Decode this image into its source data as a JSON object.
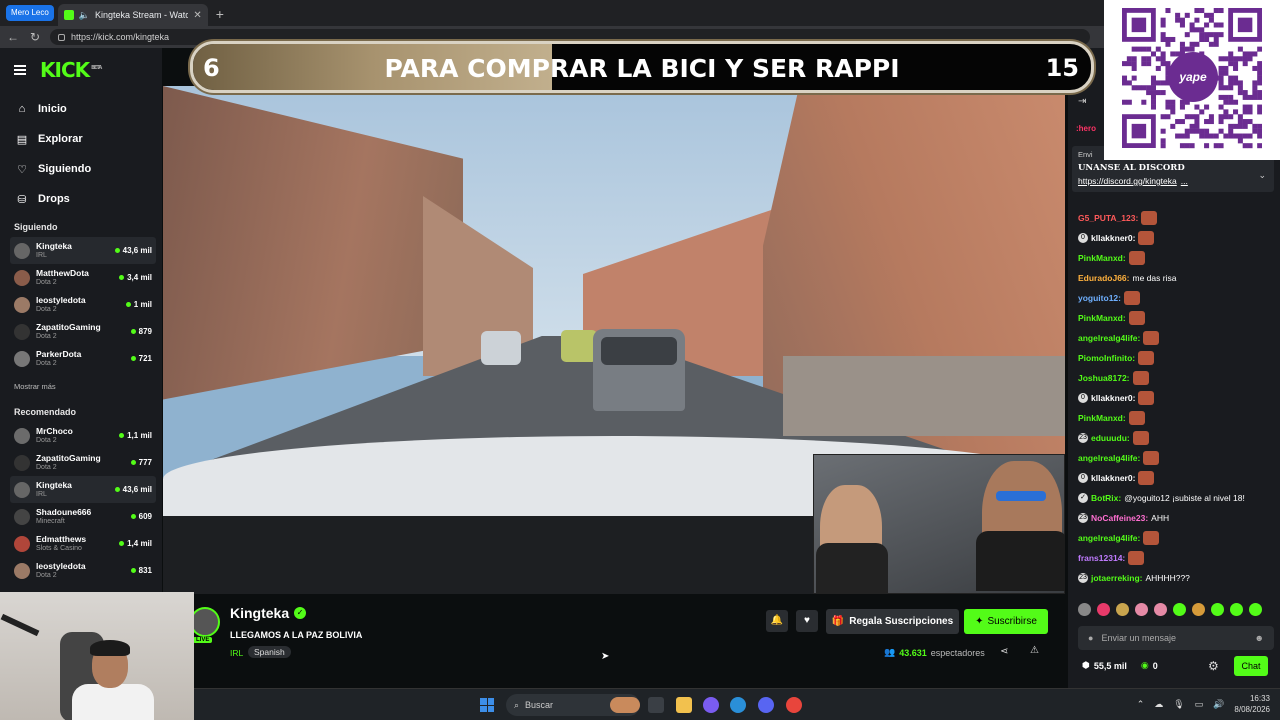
{
  "browser": {
    "tab_group": "Mero Leco",
    "tab_title": "Kingteka Stream - Watch Live",
    "url": "https://kick.com/kingteka"
  },
  "kick": {
    "logo": "KICK",
    "logo_beta": "BETA",
    "nav": [
      {
        "label": "Inicio",
        "icon": "home-icon"
      },
      {
        "label": "Explorar",
        "icon": "compass-icon"
      },
      {
        "label": "Siguiendo",
        "icon": "heart-icon"
      },
      {
        "label": "Drops",
        "icon": "drops-icon"
      }
    ],
    "following_title": "Siguiendo",
    "following": [
      {
        "name": "Kingteka",
        "category": "IRL",
        "viewers": "43,6 mil"
      },
      {
        "name": "MatthewDota",
        "category": "Dota 2",
        "viewers": "3,4 mil"
      },
      {
        "name": "leostyledota",
        "category": "Dota 2",
        "viewers": "1 mil"
      },
      {
        "name": "ZapatitoGaming",
        "category": "Dota 2",
        "viewers": "879"
      },
      {
        "name": "ParkerDota",
        "category": "Dota 2",
        "viewers": "721"
      }
    ],
    "show_more": "Mostrar más",
    "recommended_title": "Recomendado",
    "recommended": [
      {
        "name": "MrChoco",
        "category": "Dota 2",
        "viewers": "1,1 mil"
      },
      {
        "name": "ZapatitoGaming",
        "category": "Dota 2",
        "viewers": "777"
      },
      {
        "name": "Kingteka",
        "category": "IRL",
        "viewers": "43,6 mil"
      },
      {
        "name": "Shadoune666",
        "category": "Minecraft",
        "viewers": "609"
      },
      {
        "name": "Edmatthews",
        "category": "Slots & Casino",
        "viewers": "1,4 mil"
      },
      {
        "name": "leostyledota",
        "category": "Dota 2",
        "viewers": "831"
      }
    ]
  },
  "banner": {
    "left_number": "6",
    "text": "PARA COMPRAR LA BICI Y SER RAPPI",
    "right_number": "15",
    "progress": 0.4
  },
  "channel": {
    "name": "Kingteka",
    "live_badge": "LIVE",
    "title": "LLEGAMOS A LA PAZ BOLIVIA",
    "category": "IRL",
    "tag": "Spanish",
    "gift_label": "Regala Suscripciones",
    "subscribe_label": "Suscribirse",
    "viewers_count": "43.631",
    "viewers_label": "espectadores"
  },
  "chat": {
    "hero_text": ":hero",
    "pinned_prefix": "Envi",
    "pinned_title": "UNANSE AL DISCORD",
    "pinned_link": "https://discord.gg/kingteka",
    "pinned_more": "...",
    "messages": [
      {
        "user": "G5_PUTA_123:",
        "color": "#ff5a5a",
        "text": "",
        "emote": true,
        "badge": ""
      },
      {
        "user": "kllakkner0:",
        "color": "#ffffff",
        "text": "",
        "emote": true,
        "badge": "0"
      },
      {
        "user": "PinkManxd:",
        "color": "#53fc18",
        "text": "",
        "emote": true,
        "badge": ""
      },
      {
        "user": "EduradoJ66:",
        "color": "#ffb13d",
        "text": "me das risa",
        "emote": false,
        "badge": ""
      },
      {
        "user": "yoguito12:",
        "color": "#6fb0ff",
        "text": "",
        "emote": true,
        "badge": ""
      },
      {
        "user": "PinkManxd:",
        "color": "#53fc18",
        "text": "",
        "emote": true,
        "badge": ""
      },
      {
        "user": "angelrealg4life:",
        "color": "#53fc18",
        "text": "",
        "emote": true,
        "badge": ""
      },
      {
        "user": "PiomoInfinito:",
        "color": "#53fc18",
        "text": "",
        "emote": true,
        "badge": ""
      },
      {
        "user": "Joshua8172:",
        "color": "#53fc18",
        "text": "",
        "emote": true,
        "badge": ""
      },
      {
        "user": "kllakkner0:",
        "color": "#ffffff",
        "text": "",
        "emote": true,
        "badge": "0"
      },
      {
        "user": "PinkManxd:",
        "color": "#53fc18",
        "text": "",
        "emote": true,
        "badge": ""
      },
      {
        "user": "eduuudu:",
        "color": "#53fc18",
        "text": "",
        "emote": true,
        "badge": "23"
      },
      {
        "user": "angelrealg4life:",
        "color": "#53fc18",
        "text": "",
        "emote": true,
        "badge": ""
      },
      {
        "user": "kllakkner0:",
        "color": "#ffffff",
        "text": "",
        "emote": true,
        "badge": "0"
      },
      {
        "user": "BotRix:",
        "color": "#53fc18",
        "text": "@yoguito12 ¡subiste al nivel 18!",
        "emote": false,
        "badge": "✓"
      },
      {
        "user": "NoCaffeine23:",
        "color": "#ff6fd1",
        "text": "AHH",
        "emote": false,
        "badge": "23"
      },
      {
        "user": "angelrealg4life:",
        "color": "#53fc18",
        "text": "",
        "emote": true,
        "badge": ""
      },
      {
        "user": "frans12314:",
        "color": "#c07bff",
        "text": "",
        "emote": true,
        "badge": ""
      },
      {
        "user": "jotaerreking:",
        "color": "#53fc18",
        "text": "AHHHH???",
        "emote": false,
        "badge": "23"
      }
    ],
    "input_placeholder": "Enviar un mensaje",
    "points": "55,5 mil",
    "kicks": "0",
    "chat_button": "Chat"
  },
  "qr": {
    "brand": "yape"
  },
  "taskbar": {
    "search_placeholder": "Buscar",
    "time": "16:33",
    "date": "8/08/2026"
  }
}
